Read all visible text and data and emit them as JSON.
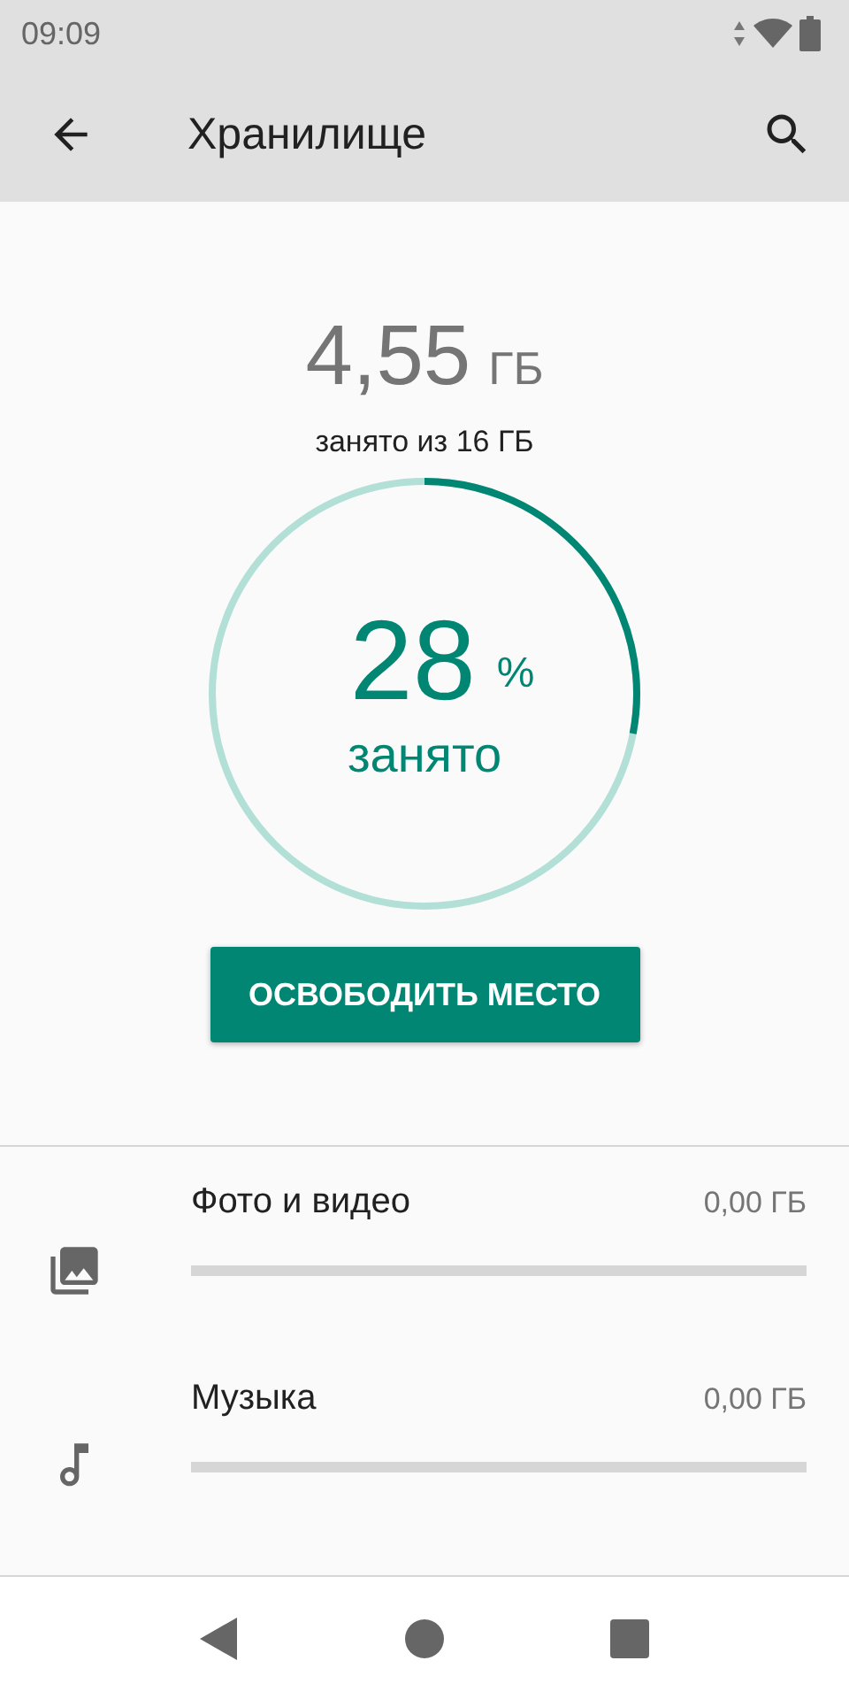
{
  "status_bar": {
    "time": "09:09"
  },
  "app_bar": {
    "title": "Хранилище"
  },
  "summary": {
    "used": "4,55",
    "unit": "ГБ",
    "caption": "занято из 16 ГБ"
  },
  "usage_ring": {
    "percent": "28",
    "percent_sign": "%",
    "label": "занято"
  },
  "free_button": {
    "label": "ОСВОБОДИТЬ МЕСТО"
  },
  "categories": [
    {
      "kind": "photos",
      "name": "Фото и видео",
      "size": "0,00 ГБ",
      "level": 0
    },
    {
      "kind": "music",
      "name": "Музыка",
      "size": "0,00 ГБ",
      "level": 0
    }
  ]
}
